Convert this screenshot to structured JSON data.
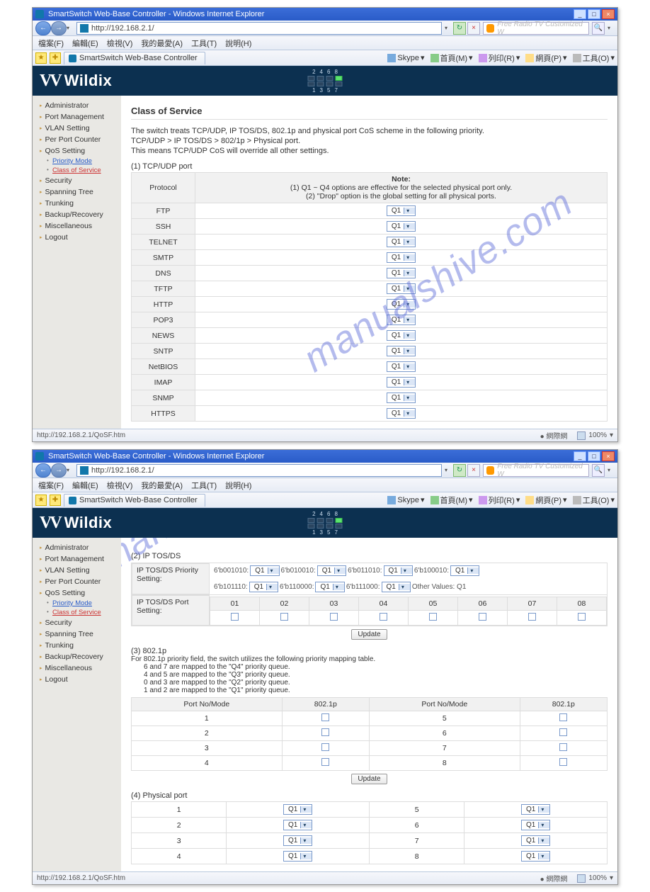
{
  "ie": {
    "title": "SmartSwitch Web-Base Controller - Windows Internet Explorer",
    "url": "http://192.168.2.1/",
    "search_placeholder": "Free Radio TV Customized W",
    "menu": [
      "檔案(F)",
      "編輯(E)",
      "檢視(V)",
      "我的最愛(A)",
      "工具(T)",
      "說明(H)"
    ],
    "tab_title": "SmartSwitch Web-Base Controller",
    "toolbar": [
      {
        "icon": "skype",
        "label": "Skype"
      },
      {
        "icon": "home",
        "label": "首頁(M)"
      },
      {
        "icon": "print",
        "label": "列印(R)"
      },
      {
        "icon": "page",
        "label": "網頁(P)"
      },
      {
        "icon": "tools",
        "label": "工具(O)"
      }
    ],
    "status_url": "http://192.168.2.1/QoSF.htm",
    "status_zone": "● 網際網",
    "zoom": "100%"
  },
  "brand": "Wildix",
  "port_header": {
    "top": [
      "2",
      "4",
      "6",
      "8"
    ],
    "bottom": [
      "1",
      "3",
      "5",
      "7"
    ]
  },
  "nav": {
    "items": [
      "Administrator",
      "Port Management",
      "VLAN Setting",
      "Per Port Counter",
      "QoS Setting"
    ],
    "sub": [
      {
        "label": "Priority Mode",
        "active": false
      },
      {
        "label": "Class of Service",
        "active": true
      }
    ],
    "items2": [
      "Security",
      "Spanning Tree",
      "Trunking",
      "Backup/Recovery",
      "Miscellaneous",
      "Logout"
    ]
  },
  "cos": {
    "title": "Class of Service",
    "desc1": "The switch treats TCP/UDP, IP TOS/DS, 802.1p and physical port CoS scheme in the following priority.",
    "desc2": "TCP/UDP > IP TOS/DS > 802/1p > Physical port.",
    "desc3": "This means TCP/UDP CoS will override all other settings.",
    "sect1_label": "(1) TCP/UDP port",
    "proto_hdr": "Protocol",
    "note_hdr": "Note:",
    "note1": "(1) Q1 ~ Q4 options are effective for the selected physical port only.",
    "note2": "(2) \"Drop\" option is the global setting for all physical ports.",
    "select_default": "Q1",
    "protocols": [
      "FTP",
      "SSH",
      "TELNET",
      "SMTP",
      "DNS",
      "TFTP",
      "HTTP",
      "POP3",
      "NEWS",
      "SNTP",
      "NetBIOS",
      "IMAP",
      "SNMP",
      "HTTPS"
    ]
  },
  "cos2": {
    "iptos_label": "(2) IP TOS/DS",
    "prio_label": "IP TOS/DS Priority Setting:",
    "port_label": "IP TOS/DS Port Setting:",
    "codes": [
      "6'b001010:",
      "6'b010010:",
      "6'b011010:",
      "6'b100010:",
      "6'b101110:",
      "6'b110000:",
      "6'b111000:",
      "Other Values: Q1"
    ],
    "port_nums": [
      "01",
      "02",
      "03",
      "04",
      "05",
      "06",
      "07",
      "08"
    ],
    "update": "Update",
    "p8021_label": "(3) 802.1p",
    "p8021_desc": "For 802.1p priority field, the switch utilizes the following priority mapping table.",
    "p8021_map": [
      "6 and 7 are mapped to the \"Q4\" priority queue.",
      "4 and 5 are mapped to the \"Q3\" priority queue.",
      "0 and 3 are mapped to the \"Q2\" priority queue.",
      "1 and 2 are mapped to the \"Q1\" priority queue."
    ],
    "col_port": "Port No/Mode",
    "col_8021p": "802.1p",
    "rows_left": [
      "1",
      "2",
      "3",
      "4"
    ],
    "rows_right": [
      "5",
      "6",
      "7",
      "8"
    ],
    "phys_label": "(4) Physical port"
  }
}
